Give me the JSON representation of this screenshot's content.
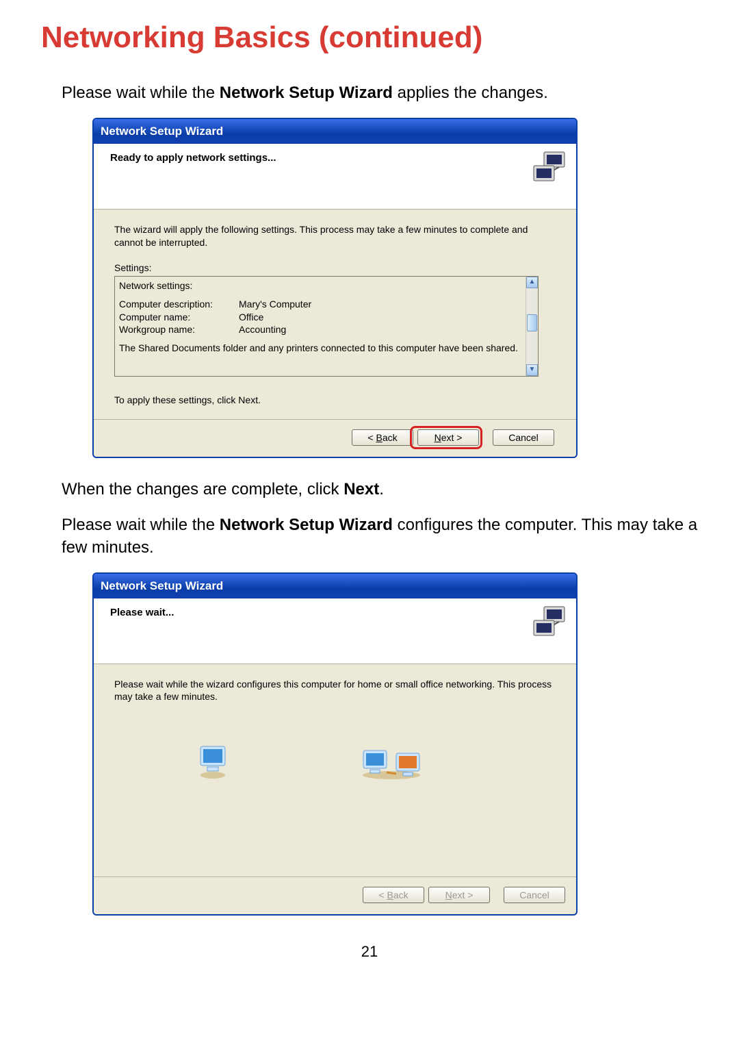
{
  "heading": "Networking Basics (continued)",
  "intro1_pre": "Please wait while the ",
  "intro1_bold": "Network Setup Wizard",
  "intro1_post": " applies the changes.",
  "wiz1": {
    "title": "Network Setup Wizard",
    "header": "Ready to apply network settings...",
    "desc": "The wizard will apply the following settings. This process may take a few minutes to complete and cannot be interrupted.",
    "settings_label": "Settings:",
    "row_ns": "Network settings:",
    "rows": [
      {
        "label": "Computer description:",
        "value": "Mary's Computer"
      },
      {
        "label": "Computer name:",
        "value": "Office"
      },
      {
        "label": "Workgroup name:",
        "value": "Accounting"
      }
    ],
    "shared": "The Shared Documents folder and any printers connected to this computer have been shared.",
    "apply_line": "To apply these settings, click Next.",
    "back_pre": "< ",
    "back_u": "B",
    "back_post": "ack",
    "next_u": "N",
    "next_post": "ext >",
    "cancel": "Cancel"
  },
  "mid1_pre": "When the changes are complete, click ",
  "mid1_bold": "Next",
  "mid1_post": ".",
  "mid2_pre": "Please wait while the ",
  "mid2_bold": "Network Setup Wizard",
  "mid2_post": " configures the computer. This may take a few minutes.",
  "wiz2": {
    "title": "Network Setup Wizard",
    "header": "Please wait...",
    "desc": "Please wait while the wizard configures this computer for home or small office networking. This process may take a few minutes.",
    "back_pre": "< ",
    "back_u": "B",
    "back_post": "ack",
    "next_u": "N",
    "next_post": "ext >",
    "cancel": "Cancel"
  },
  "pagenum": "21"
}
